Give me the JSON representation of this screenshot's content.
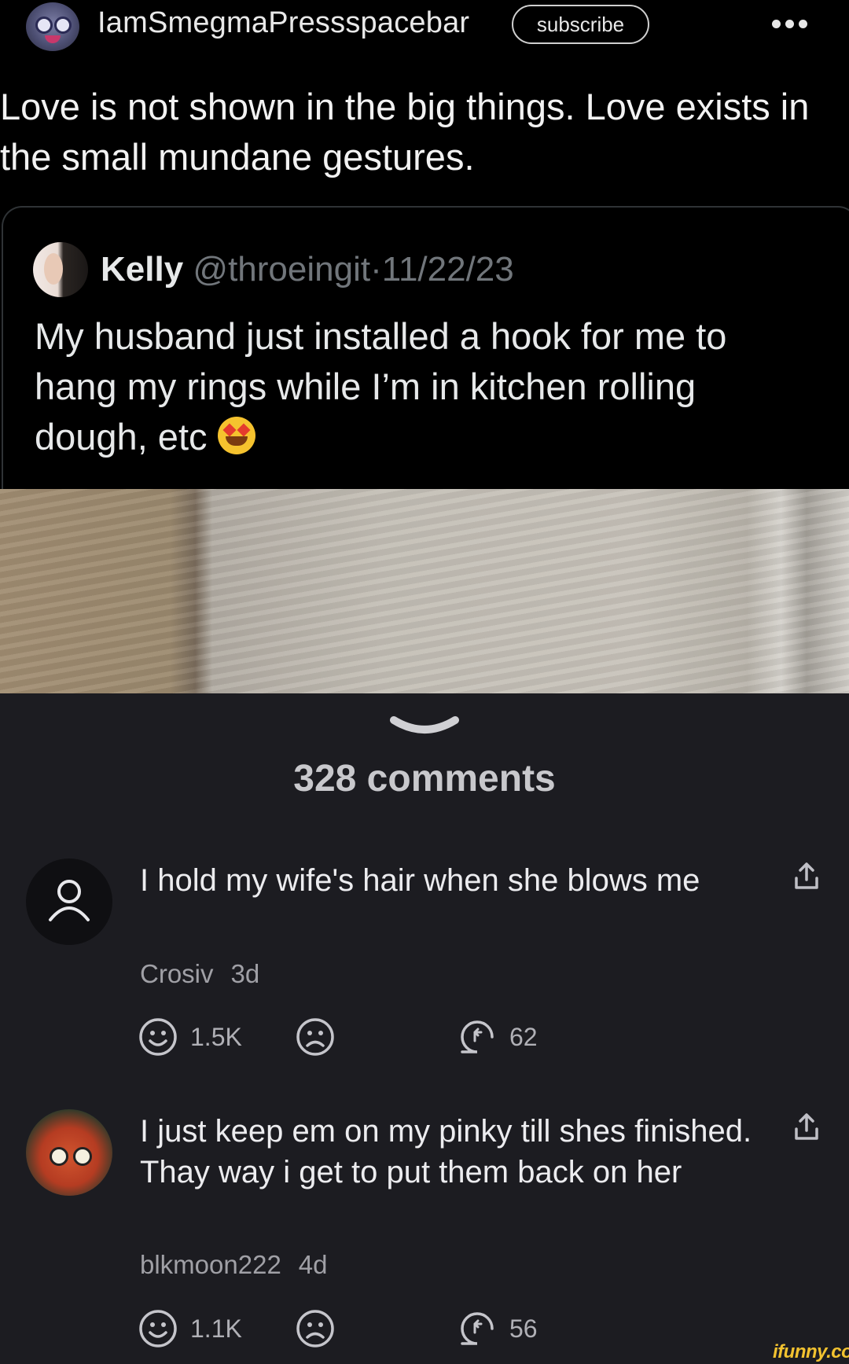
{
  "header": {
    "username": "IamSmegmaPressspacebar",
    "subscribe_label": "subscribe"
  },
  "post": {
    "title": "Love is not shown in the big things. Love exists in the small mundane gestures."
  },
  "tweet": {
    "author_name": "Kelly",
    "author_handle": "@throeingit",
    "separator": "·",
    "date": "11/22/23",
    "text": "My husband just installed a hook for me to hang my rings while I’m in kitchen rolling dough, etc"
  },
  "comments_section": {
    "title": "328 comments",
    "comments": [
      {
        "text": "I hold my wife's hair when she blows me",
        "author": "Crosiv",
        "age": "3d",
        "likes": "1.5K",
        "replies": "62"
      },
      {
        "text": "I just keep em on my pinky till shes finished. Thay way i get to put them back on her",
        "author": "blkmoon222",
        "age": "4d",
        "likes": "1.1K",
        "replies": "56"
      }
    ]
  },
  "watermark": "ifunny.co",
  "icons": [
    "more-icon",
    "chevron-down-icon",
    "user-placeholder-icon",
    "share-icon",
    "smile-icon",
    "frown-icon",
    "reply-icon"
  ],
  "colors": {
    "background_top": "#000000",
    "background_comments": "#1c1c21",
    "watermark": "#f2c230"
  }
}
